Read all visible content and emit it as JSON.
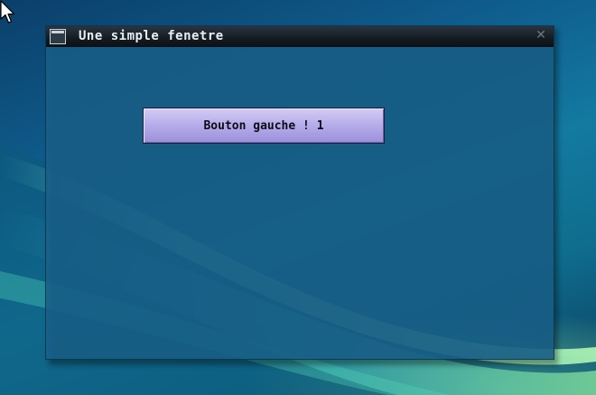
{
  "window": {
    "title": "Une simple fenetre",
    "close_glyph": "✕"
  },
  "button": {
    "label": "Bouton gauche ! 1"
  },
  "icons": {
    "window_icon": "window-app-icon",
    "close": "close-icon",
    "cursor": "mouse-pointer-icon"
  },
  "colors": {
    "button_top": "#d4ccf4",
    "button_bottom": "#9c8fdb",
    "window_body": "#18628c",
    "titlebar": "#141a20",
    "wallpaper_glow": "#96ffaa"
  }
}
